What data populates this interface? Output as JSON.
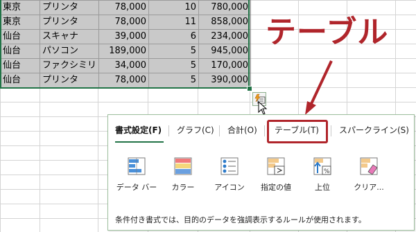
{
  "sheet": {
    "rows": [
      {
        "city": "東京",
        "product": "プリンタ",
        "price": "78,000",
        "qty": "10",
        "total": "780,000"
      },
      {
        "city": "東京",
        "product": "プリンタ",
        "price": "78,000",
        "qty": "11",
        "total": "858,000"
      },
      {
        "city": "仙台",
        "product": "スキャナ",
        "price": "39,000",
        "qty": "6",
        "total": "234,000"
      },
      {
        "city": "仙台",
        "product": "パソコン",
        "price": "189,000",
        "qty": "5",
        "total": "945,000"
      },
      {
        "city": "仙台",
        "product": "ファクシミリ",
        "price": "34,000",
        "qty": "5",
        "total": "170,000"
      },
      {
        "city": "仙台",
        "product": "プリンタ",
        "price": "78,000",
        "qty": "5",
        "total": "390,000"
      }
    ]
  },
  "callout": {
    "title": "テーブル",
    "color": "#b0252b"
  },
  "quick_analysis": {
    "tabs": [
      "書式設定(F)",
      "グラフ(C)",
      "合計(O)",
      "テーブル(T)",
      "スパークライン(S)"
    ],
    "active_tab": "書式設定(F)",
    "options": [
      "データ バー",
      "カラー",
      "アイコン",
      "指定の値",
      "上位",
      "クリア..."
    ],
    "hint": "条件付き書式では、目的のデータを強調表示するルールが使用されます。"
  },
  "colors": {
    "accent": "#217346",
    "selection": "#c9c9c9",
    "highlight": "#b0252b"
  }
}
